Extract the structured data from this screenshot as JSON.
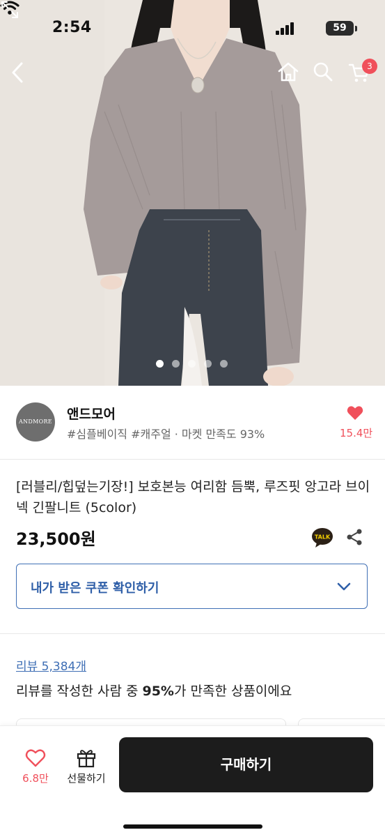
{
  "status_bar": {
    "time": "2:54",
    "battery": "59"
  },
  "top_nav": {
    "cart_count": "3"
  },
  "hero": {
    "slide_count": 5,
    "active_slide": 1
  },
  "seller": {
    "avatar_text": "ANDMORE",
    "name": "앤드모어",
    "tags": "#심플베이직 #캐주얼 · 마켓 만족도 93%",
    "likes": "15.4만"
  },
  "product": {
    "title": "[러블리/힙덮는기장!] 보호본능 여리함 듬뿍, 루즈핏 앙고라 브이넥 긴팔니트 (5color)",
    "price": "23,500원",
    "talk_label": "TALK"
  },
  "coupon": {
    "label": "내가 받은 쿠폰 확인하기"
  },
  "reviews": {
    "link": "리뷰 5,384개",
    "summary_prefix": "리뷰를 작성한 사람 중 ",
    "summary_percent": "95%",
    "summary_suffix": "가 만족한 상품이에요"
  },
  "bottom_bar": {
    "wish_count": "6.8만",
    "gift_label": "선물하기",
    "buy_label": "구매하기"
  },
  "colors": {
    "accent_blue": "#3f6fb5",
    "like_red": "#f0505b",
    "buy_button": "#1c1c1c"
  }
}
